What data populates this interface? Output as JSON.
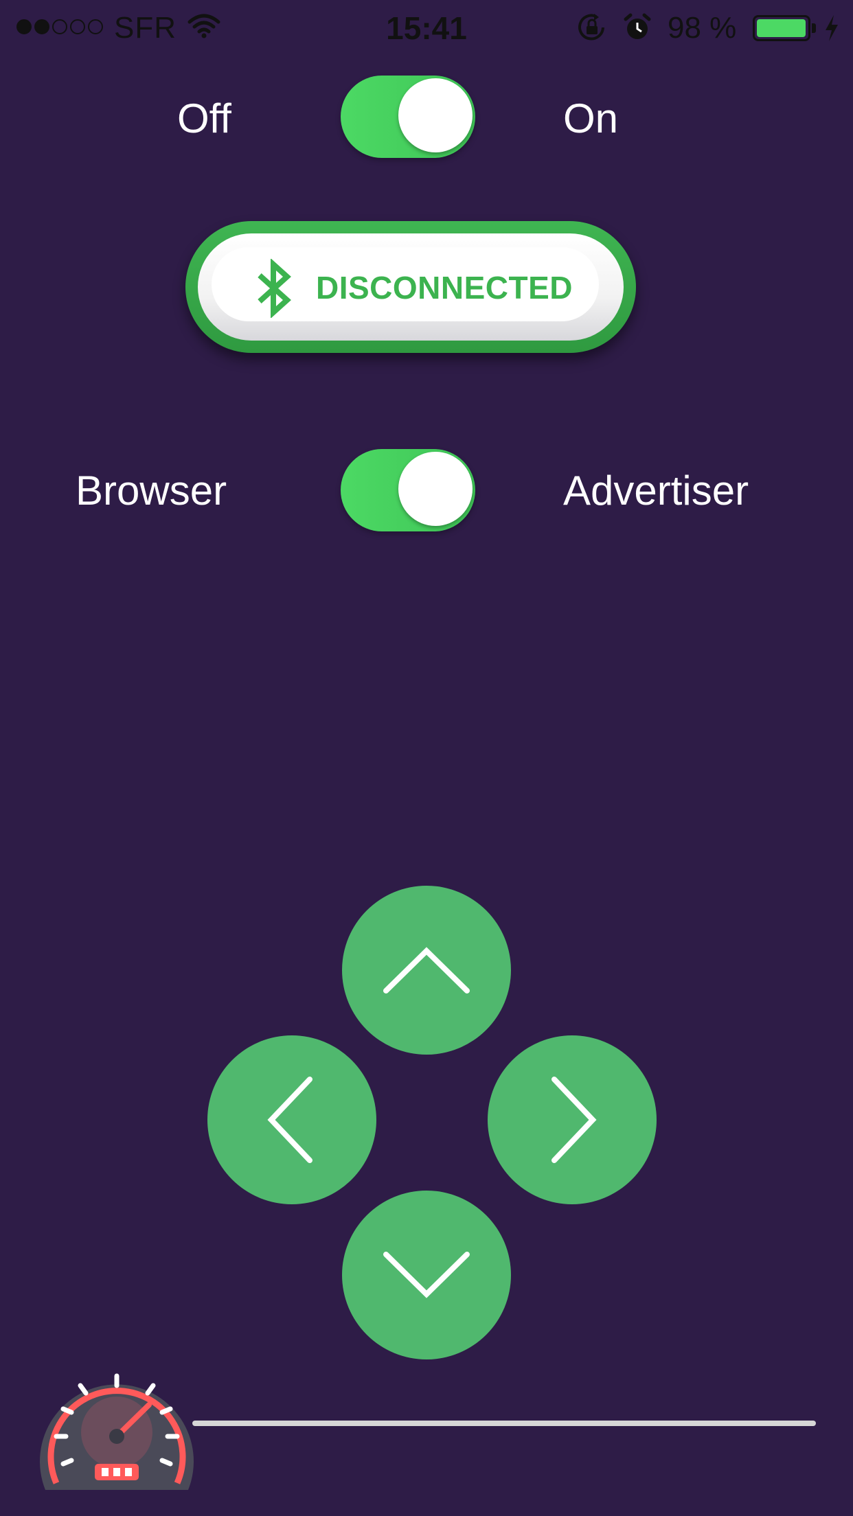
{
  "status_bar": {
    "signal_bars_filled": 2,
    "signal_bars_total": 5,
    "carrier": "SFR",
    "time": "15:41",
    "battery_percent_label": "98 %",
    "battery_level": 0.98,
    "icons": [
      "wifi-icon",
      "rotation-lock-icon",
      "alarm-icon",
      "battery-icon",
      "charging-bolt-icon"
    ]
  },
  "power_toggle": {
    "off_label": "Off",
    "on_label": "On",
    "state": "on"
  },
  "connection": {
    "icon": "bluetooth-icon",
    "status": "DISCONNECTED",
    "color": "#3cb34f"
  },
  "mode_toggle": {
    "left_label": "Browser",
    "right_label": "Advertiser",
    "state": "on"
  },
  "dpad": {
    "buttons": [
      "up",
      "left",
      "right",
      "down"
    ],
    "icons": [
      "chevron-up-icon",
      "chevron-left-icon",
      "chevron-right-icon",
      "chevron-down-icon"
    ],
    "color": "#50b86e"
  },
  "speed": {
    "icon": "speedometer-icon",
    "slider_value": 0
  },
  "colors": {
    "background": "#2e1c47",
    "toggle_on": "#4cd964",
    "accent_green": "#50b86e",
    "speedometer_red": "#ff5a5a"
  }
}
